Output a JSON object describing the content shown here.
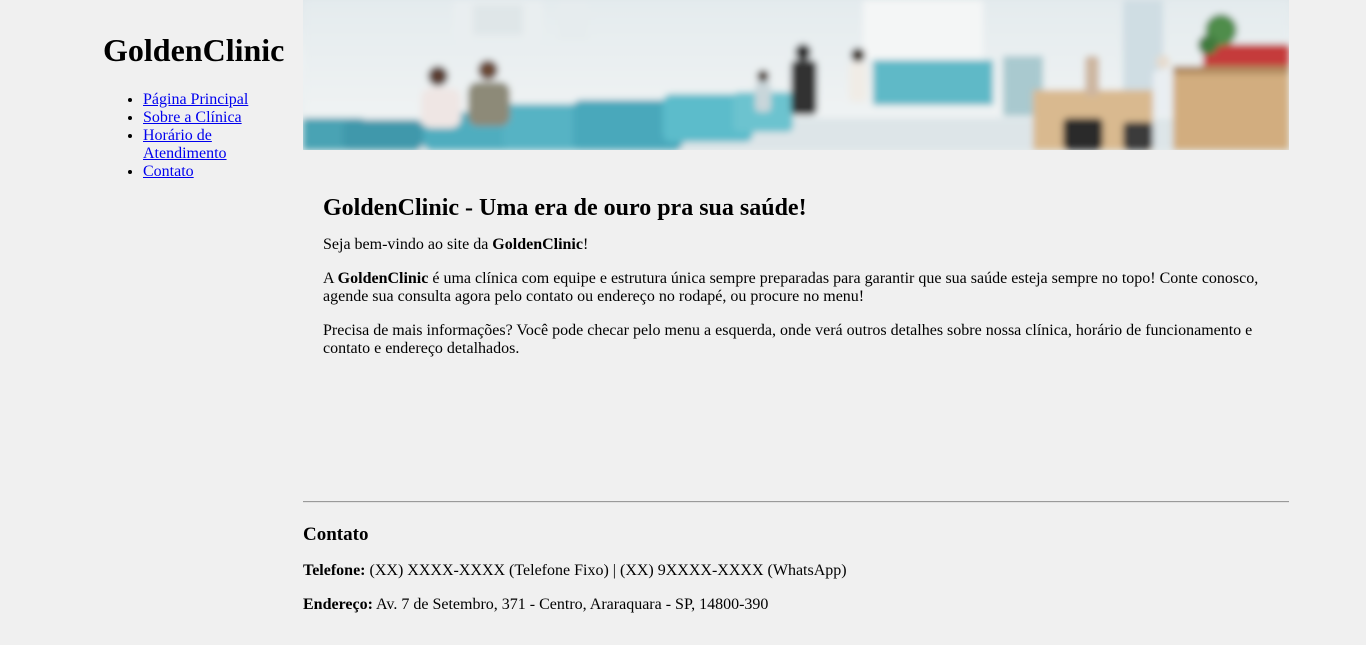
{
  "sidebar": {
    "title": "GoldenClinic",
    "nav": [
      {
        "label": "Página Principal"
      },
      {
        "label": "Sobre a Clínica"
      },
      {
        "label": "Horário de Atendimento"
      },
      {
        "label": "Contato"
      }
    ]
  },
  "banner": {
    "alt": "Sala de espera de clínica"
  },
  "main": {
    "heading": "GoldenClinic - Uma era de ouro pra sua saúde!",
    "p1_before": "Seja bem-vindo ao site da ",
    "p1_bold": "GoldenClinic",
    "p1_after": "!",
    "p2_before": "A ",
    "p2_bold": "GoldenClinic",
    "p2_after": " é uma clínica com equipe e estrutura única sempre preparadas para garantir que sua saúde esteja sempre no topo! Conte conosco, agende sua consulta agora pelo contato ou endereço no rodapé, ou procure no menu!",
    "p3": "Precisa de mais informações? Você pode checar pelo menu a esquerda, onde verá outros detalhes sobre nossa clínica, horário de funcionamento e contato e endereço detalhados."
  },
  "footer": {
    "heading": "Contato",
    "phone_label": "Telefone:",
    "phone_value": " (XX) XXXX-XXXX (Telefone Fixo) | (XX) 9XXXX-XXXX (WhatsApp)",
    "address_label": "Endereço:",
    "address_value": " Av. 7 de Setembro, 371 - Centro, Araraquara - SP, 14800-390"
  }
}
